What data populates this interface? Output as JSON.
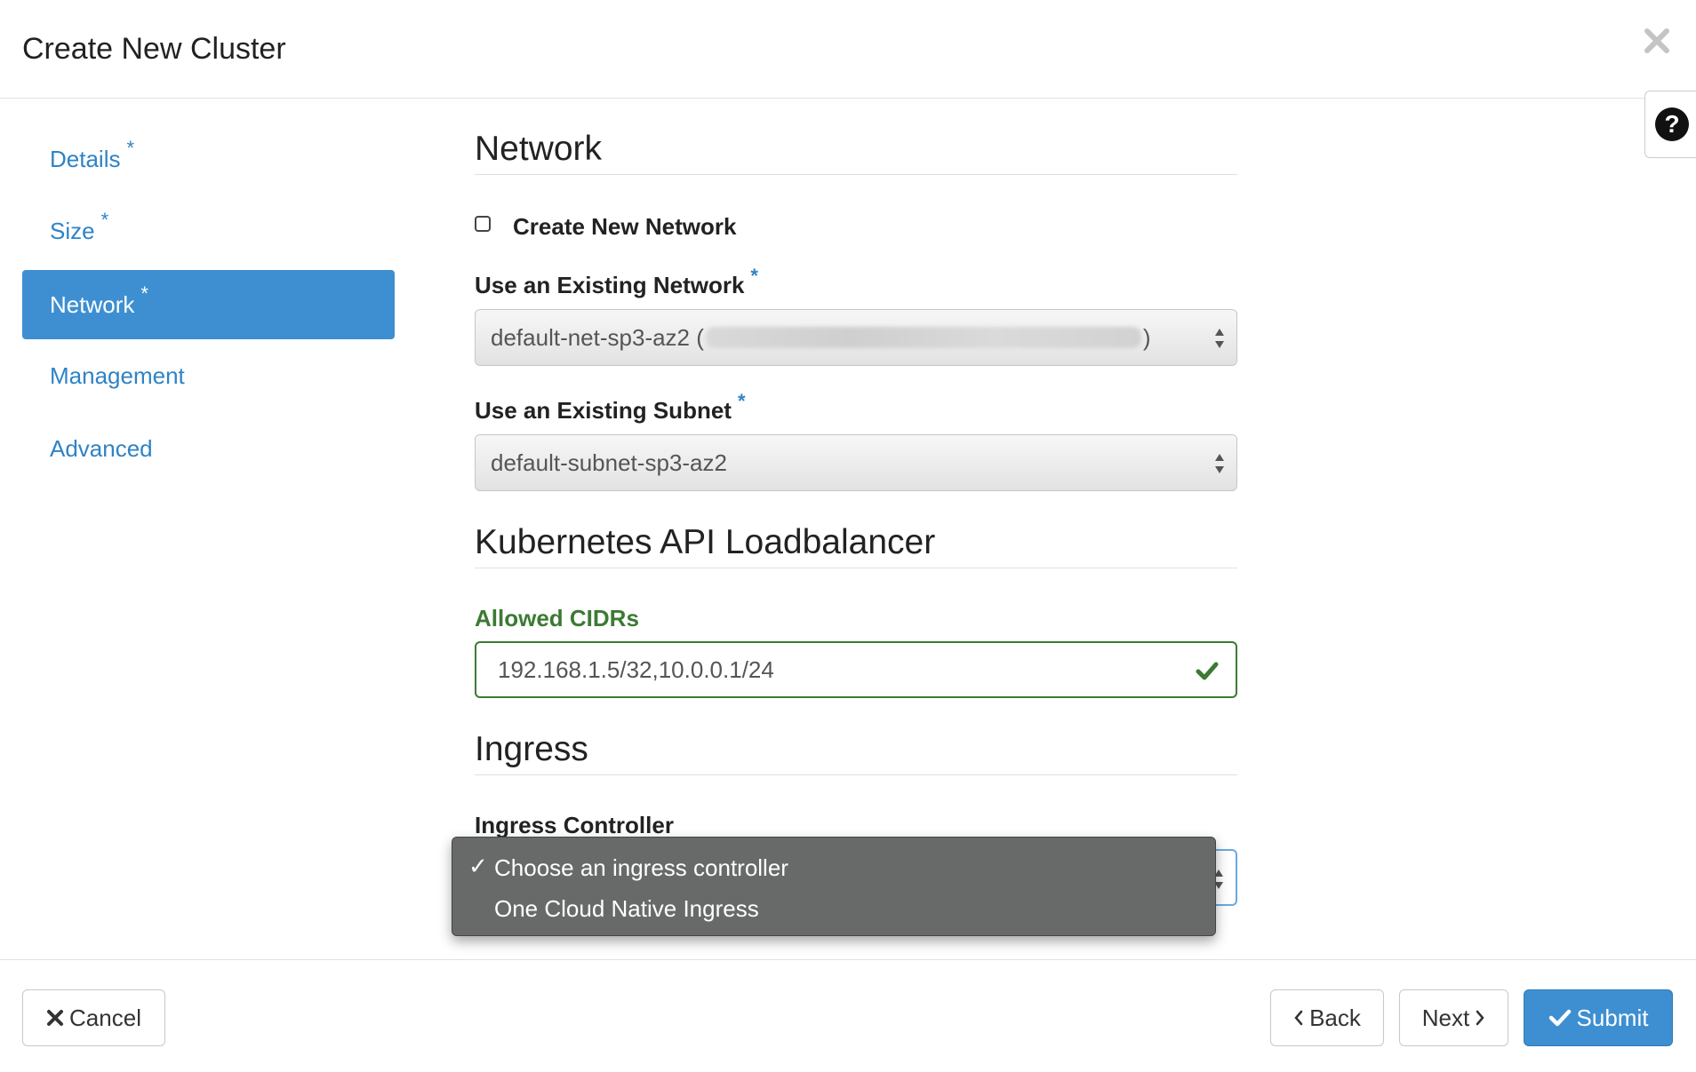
{
  "dialog": {
    "title": "Create New Cluster"
  },
  "sidebar": {
    "items": [
      {
        "label": "Details",
        "required": "*"
      },
      {
        "label": "Size",
        "required": "*"
      },
      {
        "label": "Network",
        "required": "*"
      },
      {
        "label": "Management"
      },
      {
        "label": "Advanced"
      }
    ]
  },
  "network": {
    "heading": "Network",
    "create_new_label": "Create New Network",
    "existing_network_label": "Use an Existing Network",
    "existing_network_required": "*",
    "existing_network_value_prefix": "default-net-sp3-az2 (",
    "existing_network_value_suffix": ")",
    "existing_subnet_label": "Use an Existing Subnet",
    "existing_subnet_required": "*",
    "existing_subnet_value": "default-subnet-sp3-az2"
  },
  "loadbalancer": {
    "heading": "Kubernetes API Loadbalancer",
    "cidrs_label": "Allowed CIDRs",
    "cidrs_value": "192.168.1.5/32,10.0.0.1/24"
  },
  "ingress": {
    "heading": "Ingress",
    "controller_label": "Ingress Controller",
    "options": [
      "Choose an ingress controller",
      "One Cloud Native Ingress"
    ],
    "selected_index": 0
  },
  "footer": {
    "cancel_label": "Cancel",
    "back_label": "Back",
    "next_label": "Next",
    "submit_label": "Submit"
  },
  "icons": {
    "close": "close-icon",
    "help": "question-circle-icon",
    "cancel": "x-icon",
    "back": "chevron-left-icon",
    "next": "chevron-right-icon",
    "submit": "check-icon",
    "valid": "check-icon"
  },
  "colors": {
    "primary": "#3d8fd1",
    "link": "#2f83c5",
    "success": "#3c7a34",
    "dropdown_bg": "#686a69"
  }
}
